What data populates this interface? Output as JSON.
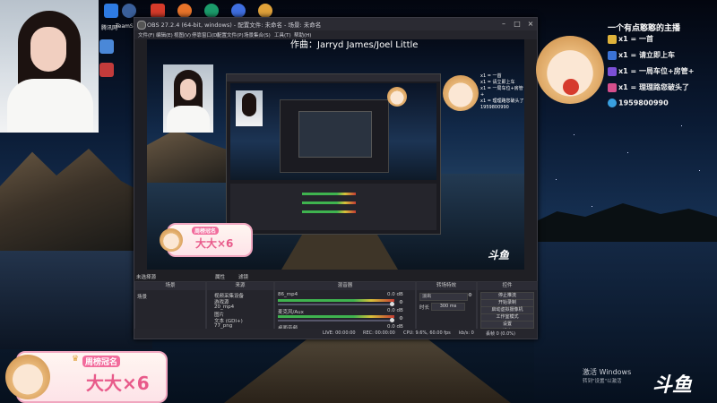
{
  "desktop": {
    "icons": [
      {
        "label": "腾讯网"
      },
      {
        "label": "TeamSp"
      },
      {
        "label": ""
      },
      {
        "label": ""
      },
      {
        "label": ""
      },
      {
        "label": ""
      },
      {
        "label": ""
      }
    ],
    "watermark": {
      "line1": "激活 Windows",
      "line2": "转到\"设置\"以激活"
    },
    "logo": "斗鱼"
  },
  "obs": {
    "title": "OBS 27.2.4 (64-bit, windows) - 配置文件: 未命名 - 场景: 未命名",
    "menu": [
      "文件(F)",
      "编辑(E)",
      "视图(V)",
      "停靠窗口(D)",
      "配置文件(P)",
      "场景集合(S)",
      "工具(T)",
      "帮助(H)"
    ],
    "preview_caption": "作曲：Jarryd James/Joel Little",
    "no_source_label": "未选择源",
    "props_label": "属性",
    "filter_label": "滤镜",
    "docks": {
      "scenes": {
        "title": "场景",
        "items": [
          "场景"
        ]
      },
      "sources": {
        "title": "来源",
        "items": [
          "视频采集设备",
          "游戏源",
          "20_mp4",
          "图片",
          "文本 (GDI+)",
          "77_png"
        ]
      },
      "mixer": {
        "title": "混音器",
        "channels": [
          {
            "name": "86_mp4",
            "db": "0.0 dB"
          },
          {
            "name": "麦克风/Aux",
            "db": "0.0 dB"
          },
          {
            "name": "桌面音频",
            "db": "0.0 dB"
          }
        ]
      },
      "transitions": {
        "title": "转场特效",
        "type": "淡出",
        "duration_label": "时长",
        "duration": "300 ms"
      },
      "controls": {
        "title": "控件",
        "buttons": [
          "停止推流",
          "开始录制",
          "启动虚拟摄像机",
          "工作室模式",
          "设置",
          "退出"
        ]
      }
    },
    "status": {
      "live": "LIVE: 00:00:00",
      "rec": "REC: 00:00:00",
      "cpu": "CPU: 9.6%, 60.00 fps",
      "kbps": "kb/s: 0",
      "dropped": "丢帧 0 (0.0%)"
    }
  },
  "overlay": {
    "streamer_tag": "一个有点憨憨的主播",
    "gifts": [
      {
        "text": "x1 = 一首"
      },
      {
        "text": "x1 = 请立即上车"
      },
      {
        "text": "x1 = 一局车位+房管+"
      },
      {
        "text": "x1 = 理理路您破头了"
      }
    ],
    "qq": "1959800990",
    "ranking": {
      "title": "周榜冠名",
      "name": "大大×6"
    },
    "ranking_small": {
      "title": "周榜冠名",
      "name": "大大×6"
    }
  },
  "colors": {
    "accent_pink": "#f26c9c",
    "obs_bg": "#1f1f24",
    "meter_green": "#3fb34f"
  }
}
